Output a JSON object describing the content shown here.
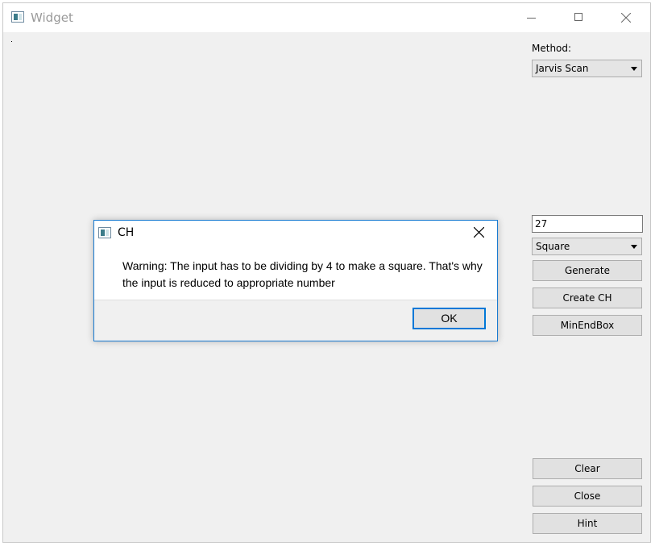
{
  "window": {
    "title": "Widget",
    "icon": "app-window-icon"
  },
  "controls": {
    "method_label": "Method:",
    "method_value": "Jarvis Scan",
    "count_value": "27",
    "shape_value": "Square",
    "generate_label": "Generate",
    "create_ch_label": "Create CH",
    "minendbox_label": "MinEndBox",
    "clear_label": "Clear",
    "close_label": "Close",
    "hint_label": "Hint"
  },
  "dialog": {
    "title": "CH",
    "message": "Warning: The input has to be dividing by 4 to make a square. That's why the input is reduced to appropriate number",
    "ok_label": "OK"
  },
  "colors": {
    "dialog_border": "#1a7bd1",
    "ok_focus": "#0078d7",
    "window_bg": "#f0f0f0"
  }
}
